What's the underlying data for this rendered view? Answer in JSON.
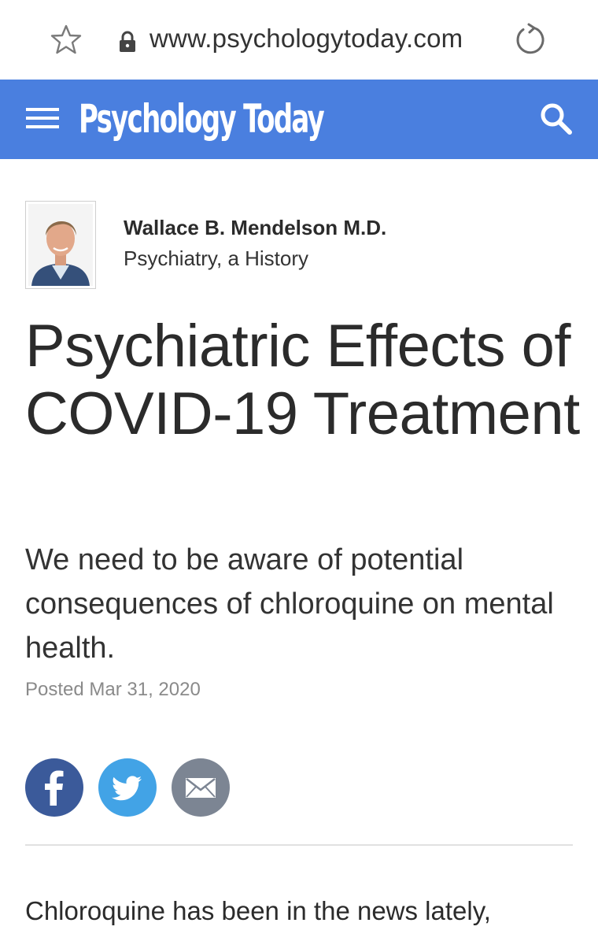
{
  "browser": {
    "url": "www.psychologytoday.com",
    "icons": [
      "star-icon",
      "lock-icon",
      "reload-icon"
    ]
  },
  "header": {
    "logo_text": "Psychology Today",
    "bg_color": "#4a7fdf",
    "icons": [
      "menu-icon",
      "search-icon"
    ]
  },
  "author": {
    "name": "Wallace B. Mendelson M.D.",
    "blog": "Psychiatry, a History"
  },
  "article": {
    "title": "Psychiatric Effects of COVID-19 Treatment",
    "subtitle": "We need to be aware of potential consequences of chloroquine on mental health.",
    "posted": "Posted Mar 31, 2020",
    "body_start": "Chloroquine has been in the news lately,"
  },
  "share": {
    "buttons": [
      {
        "name": "facebook",
        "icon": "facebook-icon",
        "color": "#3b5a9a"
      },
      {
        "name": "twitter",
        "icon": "twitter-icon",
        "color": "#42a3e6"
      },
      {
        "name": "email",
        "icon": "mail-icon",
        "color": "#7c8593"
      }
    ]
  }
}
